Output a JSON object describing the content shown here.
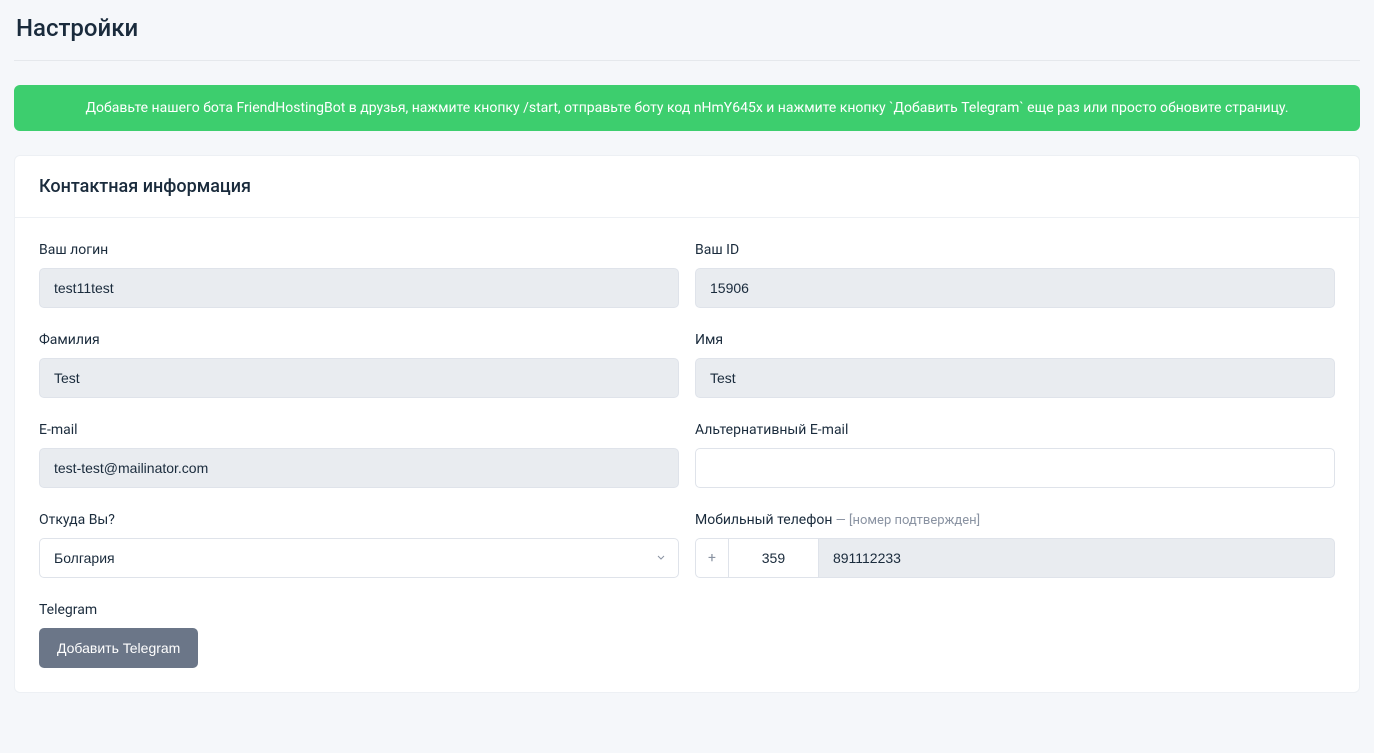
{
  "page": {
    "title": "Настройки"
  },
  "alert": {
    "message": "Добавьте нашего бота FriendHostingBot в друзья, нажмите кнопку /start, отправьте боту код nHmY645x и нажмите кнопку `Добавить Telegram` еще раз или просто обновите страницу."
  },
  "contact_section": {
    "title": "Контактная информация",
    "login": {
      "label": "Ваш логин",
      "value": "test11test"
    },
    "id": {
      "label": "Ваш ID",
      "value": "15906"
    },
    "lastname": {
      "label": "Фамилия",
      "value": "Test"
    },
    "firstname": {
      "label": "Имя",
      "value": "Test"
    },
    "email": {
      "label": "E-mail",
      "value": "test-test@mailinator.com"
    },
    "alt_email": {
      "label": "Альтернативный E-mail",
      "value": ""
    },
    "country": {
      "label": "Откуда Вы?",
      "selected": "Болгария"
    },
    "phone": {
      "label": "Мобильный телефон",
      "hint": " — [номер подтвержден]",
      "prefix": "+",
      "code": "359",
      "number": "891112233"
    },
    "telegram": {
      "label": "Telegram",
      "button": "Добавить Telegram"
    }
  }
}
